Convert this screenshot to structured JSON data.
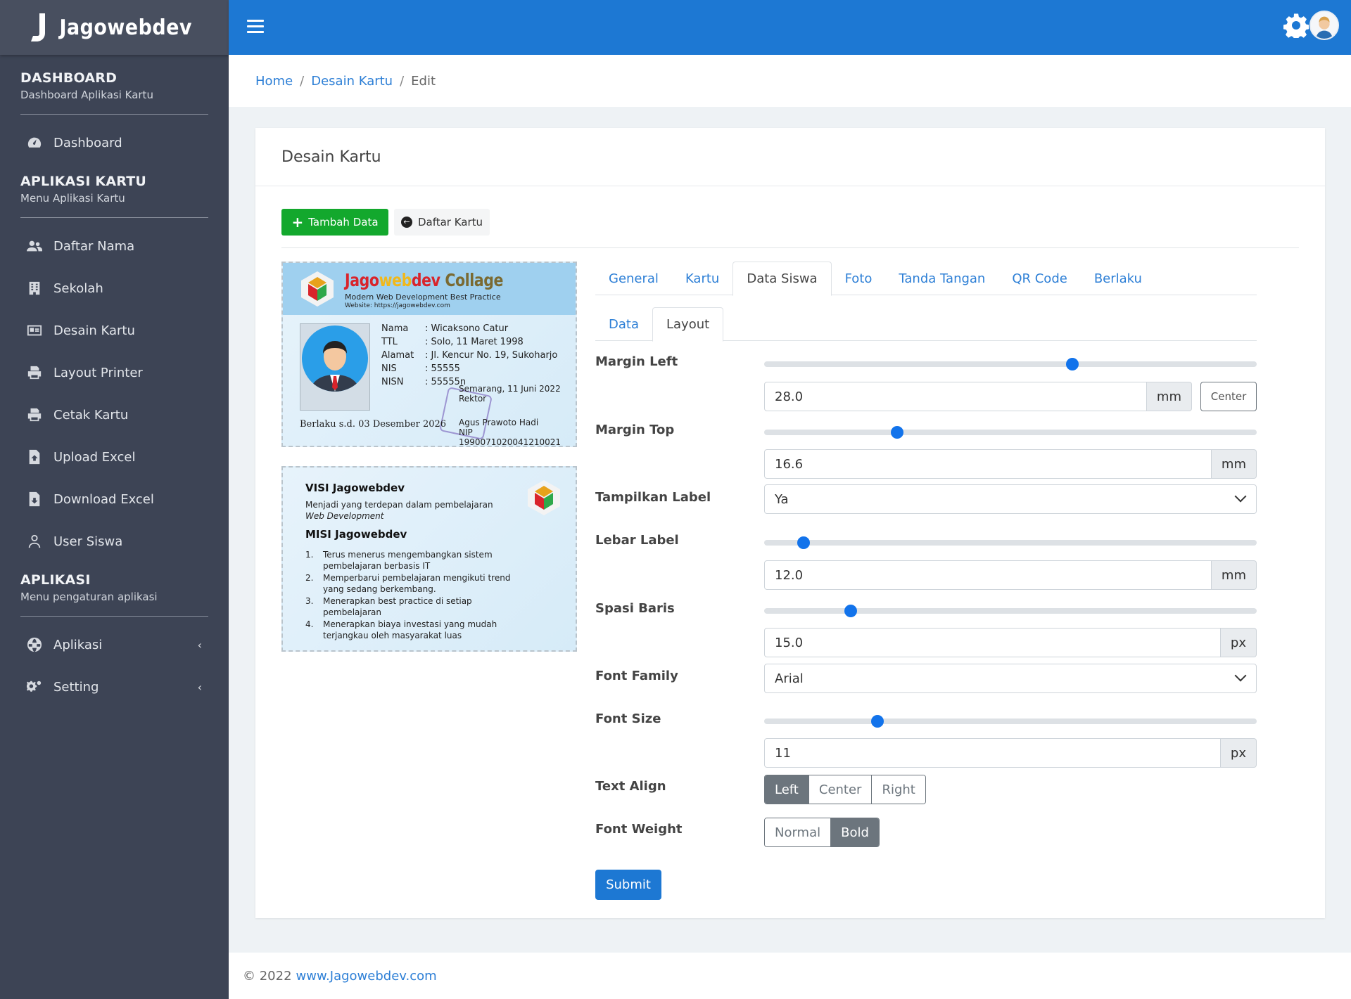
{
  "brand": {
    "name": "Jagowebdev"
  },
  "sidebar": {
    "sections": [
      {
        "title": "DASHBOARD",
        "subtitle": "Dashboard Aplikasi Kartu"
      },
      {
        "title": "APLIKASI KARTU",
        "subtitle": "Menu Aplikasi Kartu"
      },
      {
        "title": "APLIKASI",
        "subtitle": "Menu pengaturan aplikasi"
      }
    ],
    "items": [
      {
        "label": "Dashboard",
        "icon": "dashboard-icon"
      },
      {
        "label": "Daftar Nama",
        "icon": "users-icon"
      },
      {
        "label": "Sekolah",
        "icon": "building-icon"
      },
      {
        "label": "Desain Kartu",
        "icon": "id-card-icon"
      },
      {
        "label": "Layout Printer",
        "icon": "printer-icon"
      },
      {
        "label": "Cetak Kartu",
        "icon": "printer-icon"
      },
      {
        "label": "Upload Excel",
        "icon": "file-upload-icon"
      },
      {
        "label": "Download Excel",
        "icon": "file-download-icon"
      },
      {
        "label": "User Siswa",
        "icon": "user-icon"
      },
      {
        "label": "Aplikasi",
        "icon": "globe-icon"
      },
      {
        "label": "Setting",
        "icon": "gears-icon"
      }
    ],
    "chevron": "‹"
  },
  "breadcrumb": {
    "home": "Home",
    "section": "Desain Kartu",
    "current": "Edit",
    "sep": "/"
  },
  "card": {
    "title": "Desain Kartu",
    "add_button": "Tambah Data",
    "list_button": "Daftar Kartu"
  },
  "id_front": {
    "brand_a": "Jago",
    "brand_b": "web",
    "brand_c": "dev",
    "brand_d": " Collage",
    "tagline": "Modern Web Development Best Practice",
    "website": "Website: https://jagowebdev.com",
    "fields": [
      {
        "label": "Nama",
        "value": ": Wicaksono Catur"
      },
      {
        "label": "TTL",
        "value": ": Solo, 11 Maret 1998"
      },
      {
        "label": "Alamat",
        "value": ": Jl. Kencur No. 19, Sukoharjo"
      },
      {
        "label": "NIS",
        "value": ": 55555"
      },
      {
        "label": "NISN",
        "value": ": 55555n"
      }
    ],
    "valid_until": "Berlaku s.d. 03 Desember 2026",
    "sign_place": "Semarang, 11 Juni 2022",
    "sign_role": "Rektor",
    "sign_name": "Agus Prawoto Hadi",
    "sign_nip": "NIP 1990071020041210021"
  },
  "id_back": {
    "visi_title": "VISI Jagowebdev",
    "visi_text": "Menjadi yang terdepan dalam pembelajaran",
    "visi_text2": "Web Development",
    "misi_title": "MISI Jagowebdev",
    "misi": [
      {
        "n": "1.",
        "text": "Terus menerus mengembangkan sistem pembelajaran berbasis IT"
      },
      {
        "n": "2.",
        "text": "Memperbarui pembelajaran mengikuti trend yang sedang berkembang."
      },
      {
        "n": "3.",
        "text": "Menerapkan best practice di setiap pembelajaran"
      },
      {
        "n": "4.",
        "text": "Menerapkan biaya investasi yang mudah terjangkau oleh masyarakat luas"
      }
    ]
  },
  "tabs": [
    "General",
    "Kartu",
    "Data Siswa",
    "Foto",
    "Tanda Tangan",
    "QR Code",
    "Berlaku"
  ],
  "active_tab": "Data Siswa",
  "subtabs": [
    "Data",
    "Layout"
  ],
  "form": {
    "margin_left": {
      "label": "Margin Left",
      "value": "28.0",
      "unit": "mm",
      "slider": 0.625,
      "center_button": "Center"
    },
    "margin_top": {
      "label": "Margin Top",
      "value": "16.6",
      "unit": "mm",
      "slider": 0.27
    },
    "show_label": {
      "label": "Tampilkan Label",
      "value": "Ya"
    },
    "label_width": {
      "label": "Lebar Label",
      "value": "12.0",
      "unit": "mm",
      "slider": 0.08
    },
    "line_spacing": {
      "label": "Spasi Baris",
      "value": "15.0",
      "unit": "px",
      "slider": 0.175
    },
    "font_family": {
      "label": "Font Family",
      "value": "Arial"
    },
    "font_size": {
      "label": "Font Size",
      "value": "11",
      "unit": "px",
      "slider": 0.23
    },
    "text_align": {
      "label": "Text Align",
      "options": [
        "Left",
        "Center",
        "Right"
      ],
      "selected": "Left"
    },
    "font_weight": {
      "label": "Font Weight",
      "options": [
        "Normal",
        "Bold"
      ],
      "selected": "Bold"
    },
    "submit": "Submit"
  },
  "footer": {
    "copyright": "© 2022",
    "link": "www.Jagowebdev.com"
  },
  "colors": {
    "primary": "#1d78d3",
    "sidebar": "#3d4455",
    "success": "#13a82d",
    "secondary": "#6c757d"
  }
}
